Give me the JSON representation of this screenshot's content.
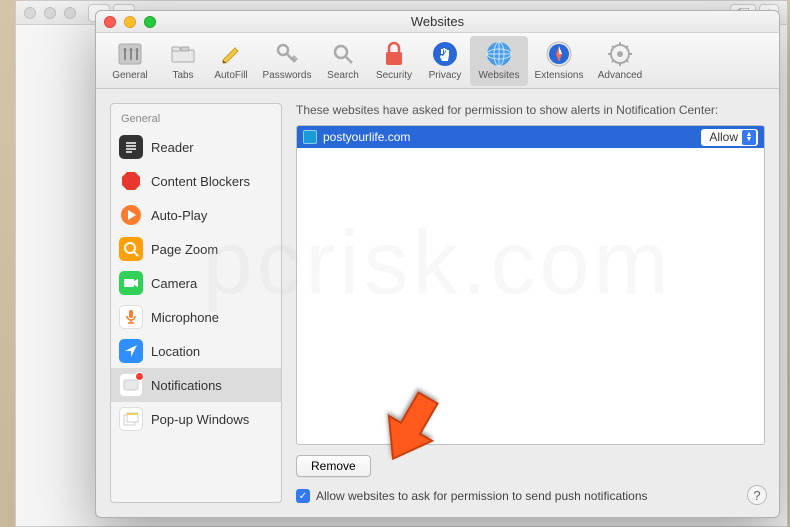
{
  "outer_window": {
    "title": ""
  },
  "prefs": {
    "title": "Websites",
    "toolbar": [
      {
        "id": "general",
        "label": "General"
      },
      {
        "id": "tabs",
        "label": "Tabs"
      },
      {
        "id": "autofill",
        "label": "AutoFill"
      },
      {
        "id": "passwords",
        "label": "Passwords"
      },
      {
        "id": "search",
        "label": "Search"
      },
      {
        "id": "security",
        "label": "Security"
      },
      {
        "id": "privacy",
        "label": "Privacy"
      },
      {
        "id": "websites",
        "label": "Websites",
        "selected": true
      },
      {
        "id": "extensions",
        "label": "Extensions"
      },
      {
        "id": "advanced",
        "label": "Advanced"
      }
    ]
  },
  "sidebar": {
    "header": "General",
    "items": [
      {
        "id": "reader",
        "label": "Reader"
      },
      {
        "id": "content-blockers",
        "label": "Content Blockers"
      },
      {
        "id": "auto-play",
        "label": "Auto-Play"
      },
      {
        "id": "page-zoom",
        "label": "Page Zoom"
      },
      {
        "id": "camera",
        "label": "Camera"
      },
      {
        "id": "microphone",
        "label": "Microphone"
      },
      {
        "id": "location",
        "label": "Location"
      },
      {
        "id": "notifications",
        "label": "Notifications",
        "selected": true,
        "badge": true
      },
      {
        "id": "popups",
        "label": "Pop-up Windows"
      }
    ]
  },
  "content": {
    "header": "These websites have asked for permission to show alerts in Notification Center:",
    "websites": [
      {
        "domain": "postyourlife.com",
        "permission": "Allow"
      }
    ],
    "remove_label": "Remove",
    "checkbox_label": "Allow websites to ask for permission to send push notifications",
    "checkbox_checked": true
  },
  "help_label": "?"
}
